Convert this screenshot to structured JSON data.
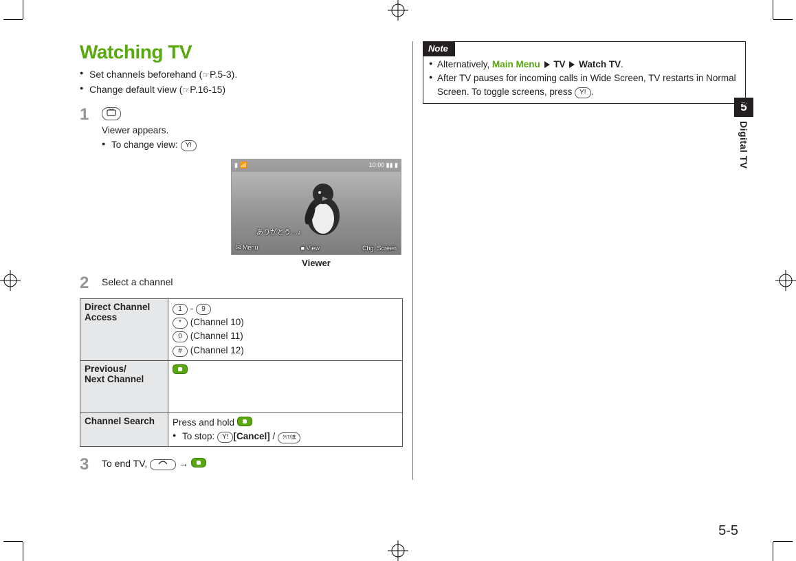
{
  "heading": "Watching TV",
  "intro_bullets": [
    {
      "text": "Set channels beforehand (",
      "ref": "P.5-3",
      "tail": ")."
    },
    {
      "text": "Change default view (",
      "ref": "P.16-15",
      "tail": ")"
    }
  ],
  "step1": {
    "line": "Viewer appears.",
    "sub": "To change view: "
  },
  "screenshot": {
    "top_left": "▮ 📶",
    "top_right": "10:00 ▮▮ ▮",
    "overlay": "ありがとう…♪",
    "bottom_left": "✉ Menu",
    "bottom_mid": "■ View",
    "bottom_right": "Chg. Screen",
    "caption": "Viewer"
  },
  "step2": {
    "text": "Select a channel",
    "table": {
      "row1_label": "Direct Channel Access",
      "row1_cells": {
        "range_from": "1",
        "range_to": "9",
        "star": "*",
        "star_label": " (Channel 10)",
        "zero": "0",
        "zero_label": " (Channel 11)",
        "hash": "#",
        "hash_label": " (Channel 12)"
      },
      "row2_label": "Previous/\nNext Channel",
      "row3_label": "Channel Search",
      "row3_line1": "Press and hold ",
      "row3_stop_pre": "To stop: ",
      "row3_stop_key": "[Cancel]",
      "row3_stop_sep": " / "
    }
  },
  "step3": {
    "pre": "To end TV, ",
    "arrow": " → "
  },
  "note": {
    "label": "Note",
    "items": {
      "alt_pre": "Alternatively, ",
      "alt_menu": "Main Menu",
      "alt_tv": "TV",
      "alt_watch": "Watch TV",
      "second": "After TV pauses for incoming calls in Wide Screen, TV restarts in Normal Screen. To toggle screens, press "
    }
  },
  "side": {
    "num": "5",
    "label": "Digital TV"
  },
  "page_num": "5-5"
}
